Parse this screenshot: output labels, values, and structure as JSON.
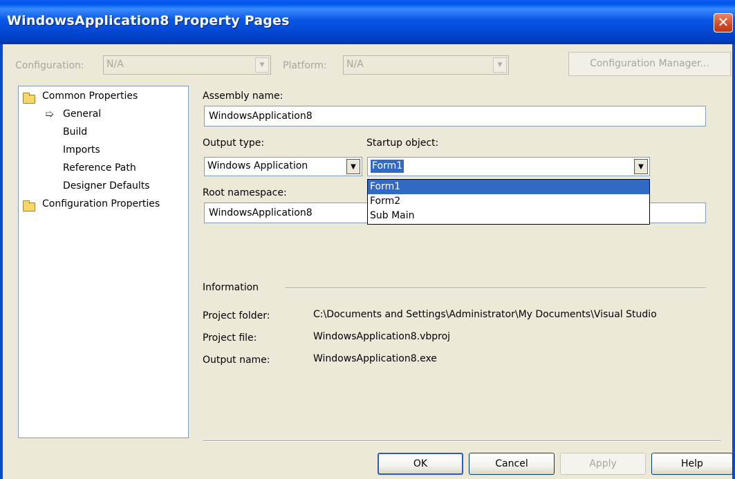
{
  "window": {
    "title": "WindowsApplication8 Property Pages",
    "close_glyph": "✕"
  },
  "toolbar": {
    "configuration_label": "Configuration:",
    "configuration_value": "N/A",
    "platform_label": "Platform:",
    "platform_value": "N/A",
    "config_manager_label": "Configuration Manager..."
  },
  "tree": {
    "items": [
      {
        "label": "Common Properties",
        "icon": "open-folder-icon"
      },
      {
        "label": "General",
        "icon": "arrow-right-icon"
      },
      {
        "label": "Build"
      },
      {
        "label": "Imports"
      },
      {
        "label": "Reference Path"
      },
      {
        "label": "Designer Defaults"
      },
      {
        "label": "Configuration Properties",
        "icon": "folder-icon"
      }
    ]
  },
  "form": {
    "assembly_name_label": "Assembly name:",
    "assembly_name_value": "WindowsApplication8",
    "output_type_label": "Output type:",
    "output_type_value": "Windows Application",
    "startup_object_label": "Startup object:",
    "startup_object_value": "Form1",
    "startup_options": [
      "Form1",
      "Form2",
      "Sub Main"
    ],
    "root_namespace_label": "Root namespace:",
    "root_namespace_value": "WindowsApplication8"
  },
  "info": {
    "heading": "Information",
    "project_folder_label": "Project folder:",
    "project_folder_value": "C:\\Documents and Settings\\Administrator\\My Documents\\Visual Studio",
    "project_file_label": "Project file:",
    "project_file_value": "WindowsApplication8.vbproj",
    "output_name_label": "Output name:",
    "output_name_value": "WindowsApplication8.exe"
  },
  "buttons": {
    "ok": "OK",
    "cancel": "Cancel",
    "apply": "Apply",
    "help": "Help"
  },
  "colors": {
    "titlebar": "#0a5cf0",
    "selection": "#316ac5",
    "dialog_bg": "#ece9d8"
  }
}
